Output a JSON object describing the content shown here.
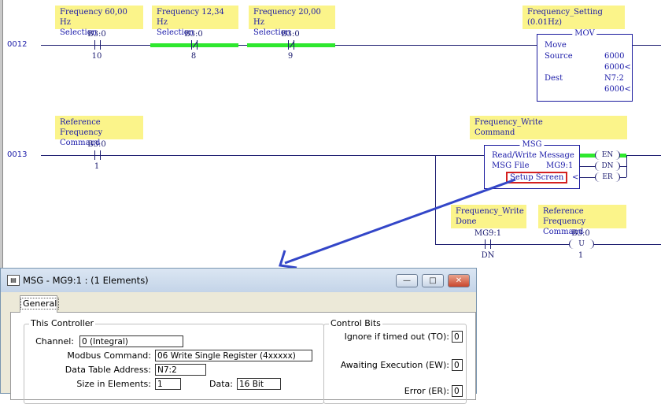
{
  "rungs": [
    {
      "number": "0012"
    },
    {
      "number": "0013"
    }
  ],
  "rung12": {
    "contacts": [
      {
        "note_line1": "Frequency 60,00 Hz",
        "note_line2": "Selection",
        "address": "B3:0",
        "bit": "10"
      },
      {
        "note_line1": "Frequency 12,34 Hz",
        "note_line2": "Selection",
        "address": "B3:0",
        "bit": "8"
      },
      {
        "note_line1": "Frequency 20,00 Hz",
        "note_line2": "Selection",
        "address": "B3:0",
        "bit": "9"
      }
    ],
    "mov": {
      "note_line1": "Frequency_Setting",
      "note_line2": "(0.01Hz)",
      "title": "MOV",
      "move_label": "Move",
      "source_label": "Source",
      "source_value": "6000",
      "source_live": "6000<",
      "dest_label": "Dest",
      "dest_value": "N7:2",
      "dest_live": "6000<"
    }
  },
  "rung13": {
    "contact": {
      "note_line1": "Reference Frequency",
      "note_line2": "Command",
      "address": "B3:0",
      "bit": "1"
    },
    "msg": {
      "note_line1": "Frequency_Write",
      "note_line2": "Command",
      "title": "MSG",
      "line1": "Read/Write Message",
      "file_label": "MSG File",
      "file_value": "MG9:1",
      "setup_label": "Setup Screen",
      "lt": "<",
      "coils": [
        "EN",
        "DN",
        "ER"
      ]
    },
    "done_contact": {
      "note_line1": "Frequency_Write",
      "note_line2": "Done",
      "address": "MG9:1",
      "bit": "DN"
    },
    "unlatch": {
      "note_line1": "Reference Frequency",
      "note_line2": "Command",
      "address": "B3:0",
      "bit": "1",
      "symbol": "U"
    }
  },
  "dialog": {
    "title": "MSG - MG9:1 : (1 Elements)",
    "buttons": {
      "minimize": "—",
      "maximize": "□",
      "close": "✕"
    },
    "tab": "General",
    "this_controller": {
      "legend": "This Controller",
      "channel_label": "Channel:",
      "channel_value": "0 (Integral)",
      "modbus_label": "Modbus Command:",
      "modbus_value": "06 Write Single Register (4xxxxx)",
      "dta_label": "Data Table Address:",
      "dta_value": "N7:2",
      "size_label": "Size in Elements:",
      "size_value": "1",
      "data_label": "Data:",
      "data_value": "16 Bit"
    },
    "control_bits": {
      "legend": "Control Bits",
      "to_label": "Ignore if timed out (TO):",
      "to_value": "0",
      "ew_label": "Awaiting Execution (EW):",
      "ew_value": "0",
      "er_label": "Error (ER):",
      "er_value": "0"
    }
  },
  "colors": {
    "note": "#fbf48a",
    "energized": "#2ee82e",
    "arrow": "#3346c8",
    "highlight": "#d42020"
  }
}
